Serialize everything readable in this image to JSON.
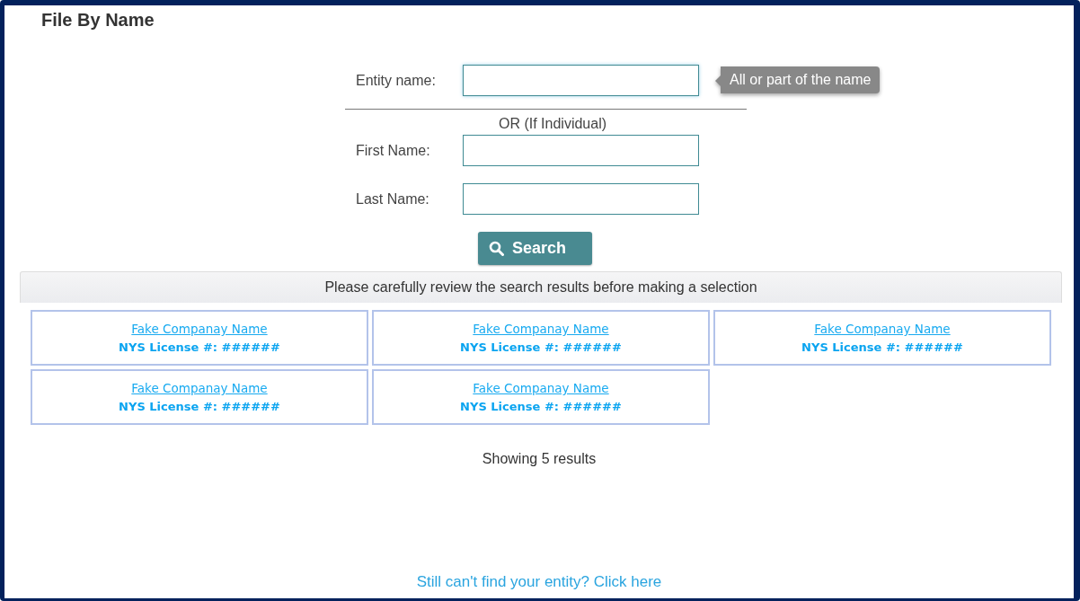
{
  "title": "File By Name",
  "entity_field": {
    "label": "Entity name:",
    "focused": true,
    "tooltip": "All or part of the name"
  },
  "separator_text": "OR (If Individual)",
  "individual_fields": [
    {
      "label": "First Name:"
    },
    {
      "label": "Last Name:"
    }
  ],
  "search_button": {
    "label": "Search"
  },
  "results_header": "Please carefully review the search results before making a selection",
  "results": [
    {
      "name": "Fake Companay Name",
      "license": "NYS License #: ######"
    },
    {
      "name": "Fake Companay Name",
      "license": "NYS License #: ######"
    },
    {
      "name": "Fake Companay Name",
      "license": "NYS License #: ######"
    },
    {
      "name": "Fake Companay Name",
      "license": "NYS License #: ######"
    },
    {
      "name": "Fake Companay Name",
      "license": "NYS License #: ######"
    }
  ],
  "results_count": "Showing 5 results",
  "help_link": "Still can't find your entity? Click here"
}
